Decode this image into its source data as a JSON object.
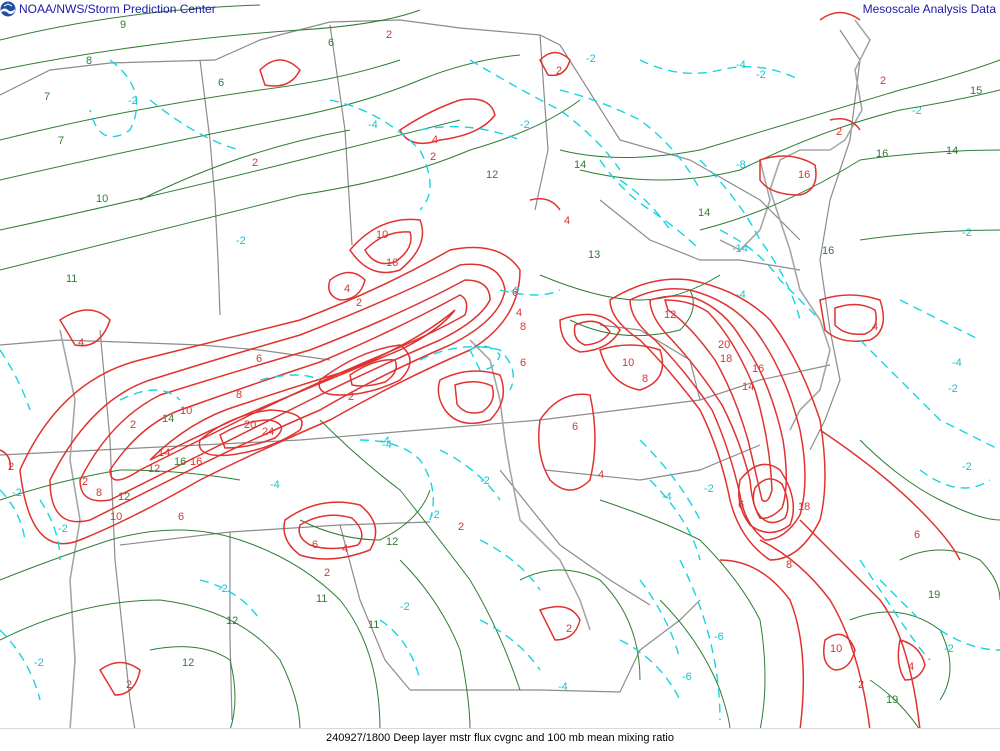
{
  "header": {
    "left_title": "NOAA/NWS/Storm Prediction Center",
    "right_title": "Mesoscale Analysis Data"
  },
  "footer": {
    "caption": "240927/1800 Deep layer mstr flux cvgnc and 100 mb mean mixing ratio"
  },
  "icons": {
    "logo": "noaa-logo-icon"
  },
  "colors": {
    "background": "#ffffff",
    "mixing_ratio_contour": "#2e7d32",
    "convergence_contour": "#e0322f",
    "divergence_contour": "#17d4e0",
    "borders": "#8c8c8c",
    "header_text": "#1a1aa6"
  },
  "layers": [
    {
      "name": "100 mb mean mixing ratio",
      "style": "green solid contours"
    },
    {
      "name": "Deep layer mstr flux cvgnc (positive)",
      "style": "red solid contours"
    },
    {
      "name": "Deep layer mstr flux cvgnc (negative)",
      "style": "cyan dashed contours"
    }
  ],
  "contour_labels": {
    "mixing_ratio": [
      "9",
      "6",
      "8",
      "7",
      "7",
      "10",
      "11",
      "6",
      "12",
      "14",
      "14",
      "14",
      "15",
      "16",
      "14",
      "16",
      "13",
      "12",
      "11",
      "12",
      "11",
      "12",
      "19",
      "19",
      "12",
      "16"
    ],
    "convergence": [
      "2",
      "2",
      "4",
      "2",
      "4",
      "2",
      "8",
      "2",
      "10",
      "12",
      "14",
      "16",
      "6",
      "6",
      "4",
      "2",
      "6",
      "8",
      "10",
      "20",
      "24",
      "4",
      "2",
      "4",
      "6",
      "8",
      "10",
      "16",
      "2",
      "6",
      "12",
      "18",
      "14",
      "20",
      "16",
      "18",
      "10",
      "8",
      "6",
      "4",
      "2",
      "2",
      "4",
      "6",
      "8",
      "4",
      "10",
      "2",
      "16",
      "2",
      "4",
      "6",
      "2",
      "2",
      "2",
      "2"
    ],
    "divergence": [
      "-2",
      "-4",
      "-2",
      "-2",
      "-4",
      "-2",
      "-2",
      "-4",
      "-2",
      "-2",
      "-2",
      "-6",
      "-4",
      "-2",
      "-4",
      "-2",
      "-8",
      "-4",
      "-2",
      "-6",
      "-2",
      "-4",
      "-14",
      "-2",
      "-4",
      "-2",
      "-2",
      "-2",
      "-4",
      "-2",
      "-2",
      "-2"
    ]
  }
}
